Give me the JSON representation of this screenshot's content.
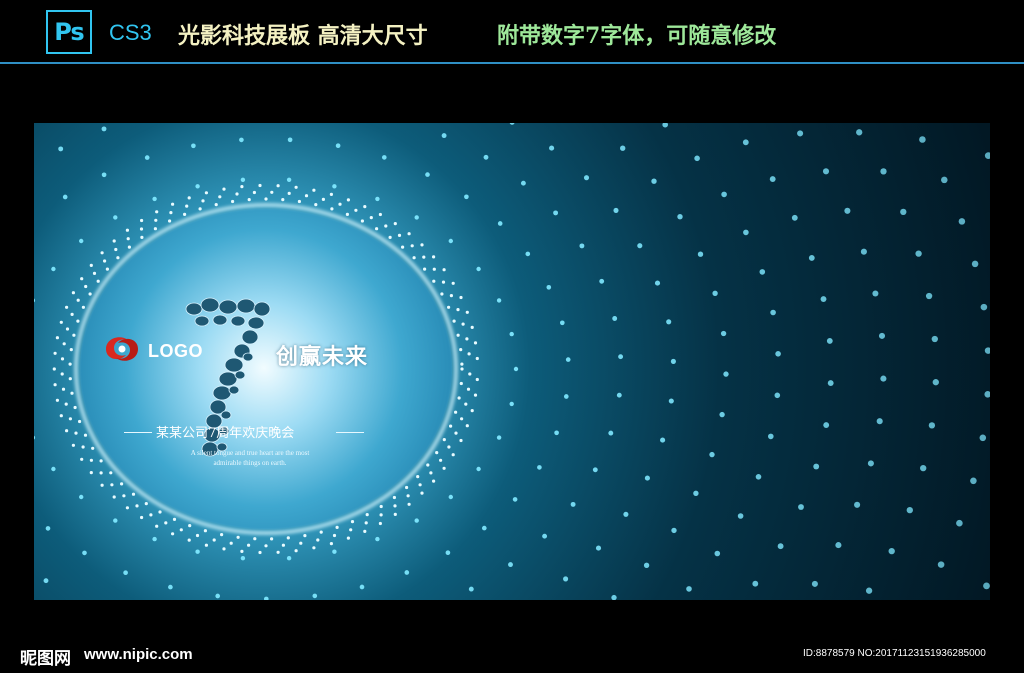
{
  "header": {
    "ps_icon_label": "Ps",
    "version": "CS3",
    "title_main": "光影科技展板  高清大尺寸",
    "title_sub": "附带数字7字体，可随意修改"
  },
  "poster": {
    "logo_text": "LOGO",
    "big_number": "7",
    "slogan": "创赢未来",
    "event_title": "某某公司7周年欢庆晚会",
    "english_line1": "A silent tongue and true heart are the most",
    "english_line2": "admirable things on earth.",
    "colors": {
      "glow": "#7fe8ff",
      "deep": "#02202e",
      "center": "#dff6ff",
      "logo_red": "#d8281f",
      "seven": "#1f5873"
    }
  },
  "watermark": {
    "brand": "昵图网",
    "site": "www.nipic.com",
    "id_text": "ID:8878579 NO:20171123151936285000"
  }
}
